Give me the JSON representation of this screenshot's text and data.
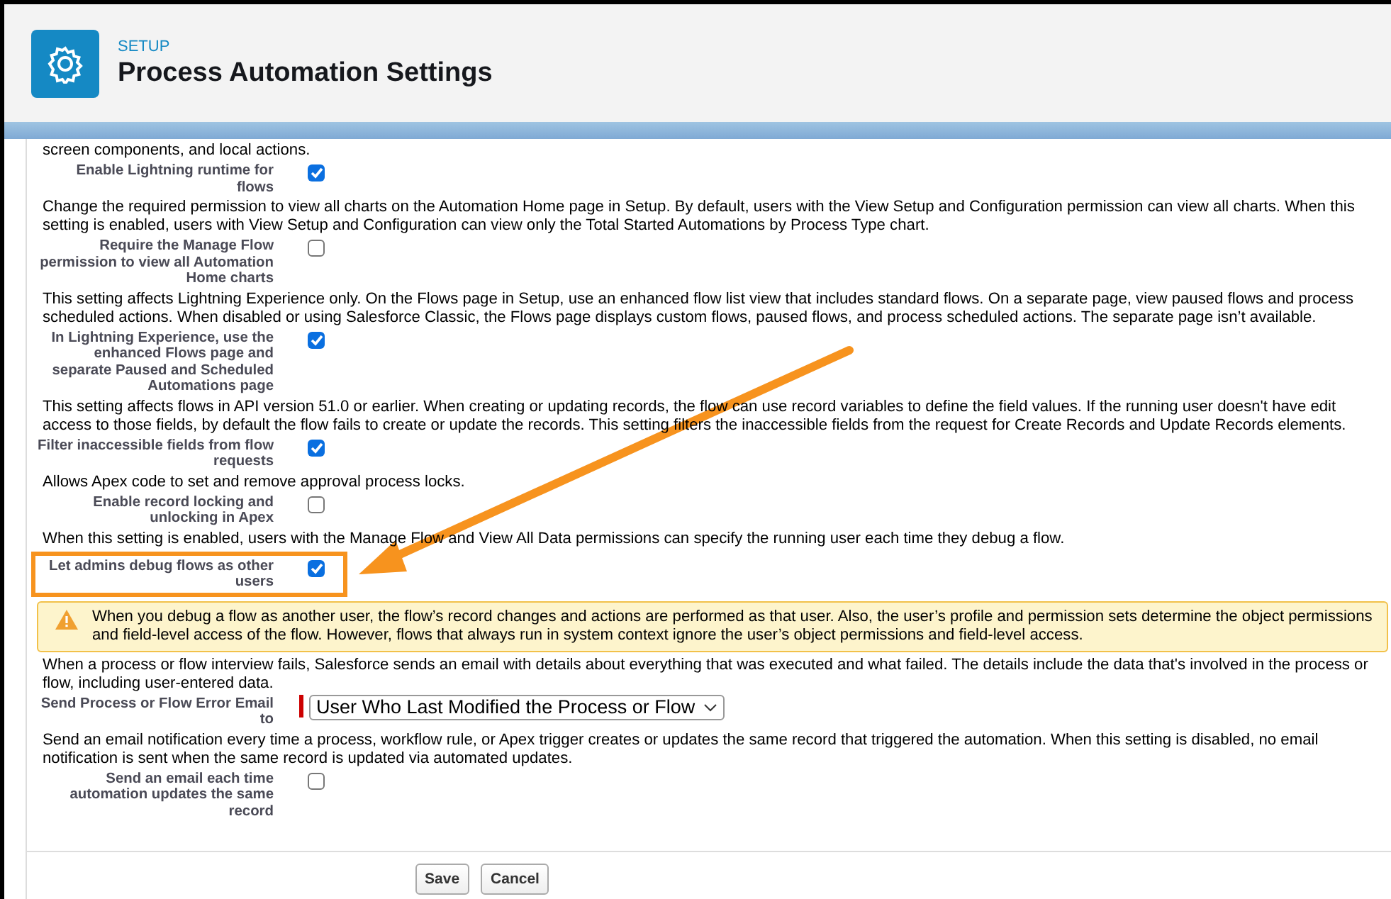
{
  "header": {
    "eyebrow": "SETUP",
    "title": "Process Automation Settings"
  },
  "settings": [
    {
      "kind": "text",
      "text": "screen components, and local actions."
    },
    {
      "kind": "checkbox",
      "label": "Enable Lightning runtime for flows",
      "checked": true,
      "highlighted": false
    },
    {
      "kind": "text",
      "text": "Change the required permission to view all charts on the Automation Home page in Setup. By default, users with the View Setup and Configuration permission can view all charts. When this setting is enabled, users with View Setup and Configuration can view only the Total Started Automations by Process Type chart."
    },
    {
      "kind": "checkbox",
      "label": "Require the Manage Flow permission to view all Automation Home charts",
      "checked": false,
      "highlighted": false
    },
    {
      "kind": "text",
      "text": "This setting affects Lightning Experience only. On the Flows page in Setup, use an enhanced flow list view that includes standard flows. On a separate page, view paused flows and process scheduled actions. When disabled or using Salesforce Classic, the Flows page displays custom flows, paused flows, and process scheduled actions. The separate page isn’t available."
    },
    {
      "kind": "checkbox",
      "label": "In Lightning Experience, use the enhanced Flows page and separate Paused and Scheduled Automations page",
      "checked": true,
      "highlighted": false
    },
    {
      "kind": "text",
      "text": "This setting affects flows in API version 51.0 or earlier. When creating or updating records, the flow can use record variables to define the field values. If the running user doesn't have edit access to those fields, by default the flow fails to create or update the records. This setting filters the inaccessible fields from the request for Create Records and Update Records elements."
    },
    {
      "kind": "checkbox",
      "label": "Filter inaccessible fields from flow requests",
      "checked": true,
      "highlighted": false
    },
    {
      "kind": "text",
      "text": "Allows Apex code to set and remove approval process locks."
    },
    {
      "kind": "checkbox",
      "label": "Enable record locking and unlocking in Apex",
      "checked": false,
      "highlighted": false
    },
    {
      "kind": "text",
      "text": "When this setting is enabled, users with the Manage Flow and View All Data permissions can specify the running user each time they debug a flow."
    },
    {
      "kind": "checkbox",
      "label": "Let admins debug flows as other users",
      "checked": true,
      "highlighted": true
    },
    {
      "kind": "warning",
      "text": "When you debug a flow as another user, the flow’s record changes and actions are performed as that user. Also, the user’s profile and permission sets determine the object permissions and field-level access of the flow. However, flows that always run in system context ignore the user’s object permissions and field-level access."
    },
    {
      "kind": "text",
      "text": "When a process or flow interview fails, Salesforce sends an email with details about everything that was executed and what failed. The details include the data that's involved in the process or flow, including user-entered data."
    },
    {
      "kind": "select",
      "label": "Send Process or Flow Error Email to",
      "value": "User Who Last Modified the Process or Flow",
      "required": true
    },
    {
      "kind": "text",
      "text": "Send an email notification every time a process, workflow rule, or Apex trigger creates or updates the same record that triggered the automation. When this setting is disabled, no email notification is sent when the same record is updated via automated updates."
    },
    {
      "kind": "checkbox",
      "label": "Send an email each time automation updates the same record",
      "checked": false,
      "highlighted": false
    }
  ],
  "buttons": [
    "Save",
    "Cancel"
  ]
}
